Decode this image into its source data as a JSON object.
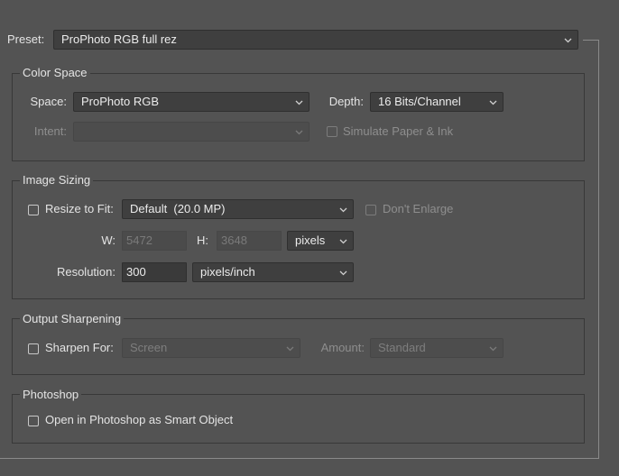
{
  "preset": {
    "label": "Preset:",
    "value": "ProPhoto RGB full rez"
  },
  "color_space": {
    "title": "Color Space",
    "space_label": "Space:",
    "space_value": "ProPhoto RGB",
    "depth_label": "Depth:",
    "depth_value": "16 Bits/Channel",
    "intent_label": "Intent:",
    "intent_value": "",
    "simulate_label": "Simulate Paper & Ink"
  },
  "image_sizing": {
    "title": "Image Sizing",
    "resize_label": "Resize to Fit:",
    "resize_value": "Default  (20.0 MP)",
    "dont_enlarge_label": "Don't Enlarge",
    "w_label": "W:",
    "w_value": "5472",
    "h_label": "H:",
    "h_value": "3648",
    "units_value": "pixels",
    "resolution_label": "Resolution:",
    "resolution_value": "300",
    "resolution_units": "pixels/inch"
  },
  "output_sharpening": {
    "title": "Output Sharpening",
    "sharpen_label": "Sharpen For:",
    "sharpen_value": "Screen",
    "amount_label": "Amount:",
    "amount_value": "Standard"
  },
  "photoshop": {
    "title": "Photoshop",
    "smart_object_label": "Open in Photoshop as Smart Object"
  },
  "colors": {
    "background": "#535353",
    "control": "#3f3f3f",
    "text": "#e4e4e4",
    "disabled_text": "#8e8e8e"
  }
}
